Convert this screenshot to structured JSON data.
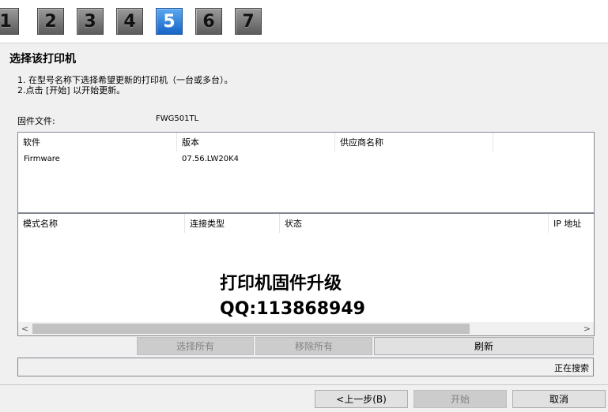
{
  "steps": [
    "1",
    "2",
    "3",
    "4",
    "5",
    "6",
    "7"
  ],
  "active_step": "5",
  "title": "选择该打印机",
  "instructions": [
    "1. 在型号名称下选择希望更新的打印机（一台或多台）。",
    "2.点击 [开始] 以开始更新。"
  ],
  "firmware": {
    "label": "固件文件:",
    "value": "FWG501TL"
  },
  "software_table": {
    "headers": [
      "软件",
      "版本",
      "供应商名称"
    ],
    "rows": [
      {
        "software": "Firmware",
        "version": "07.56.LW20K4",
        "vendor": ""
      }
    ]
  },
  "printer_table": {
    "headers": [
      "模式名称",
      "连接类型",
      "状态",
      "IP 地址"
    ]
  },
  "watermark": {
    "line1": "打印机固件升级",
    "line2": "QQ:113868949"
  },
  "scroll_arrows": {
    "left": "<",
    "right": ">"
  },
  "buttons": {
    "select_all": "选择所有",
    "remove_all": "移除所有",
    "refresh": "刷新"
  },
  "status_text": "正在搜索",
  "footer": {
    "back": "<上一步(B)",
    "start": "开始",
    "cancel": "取消"
  }
}
